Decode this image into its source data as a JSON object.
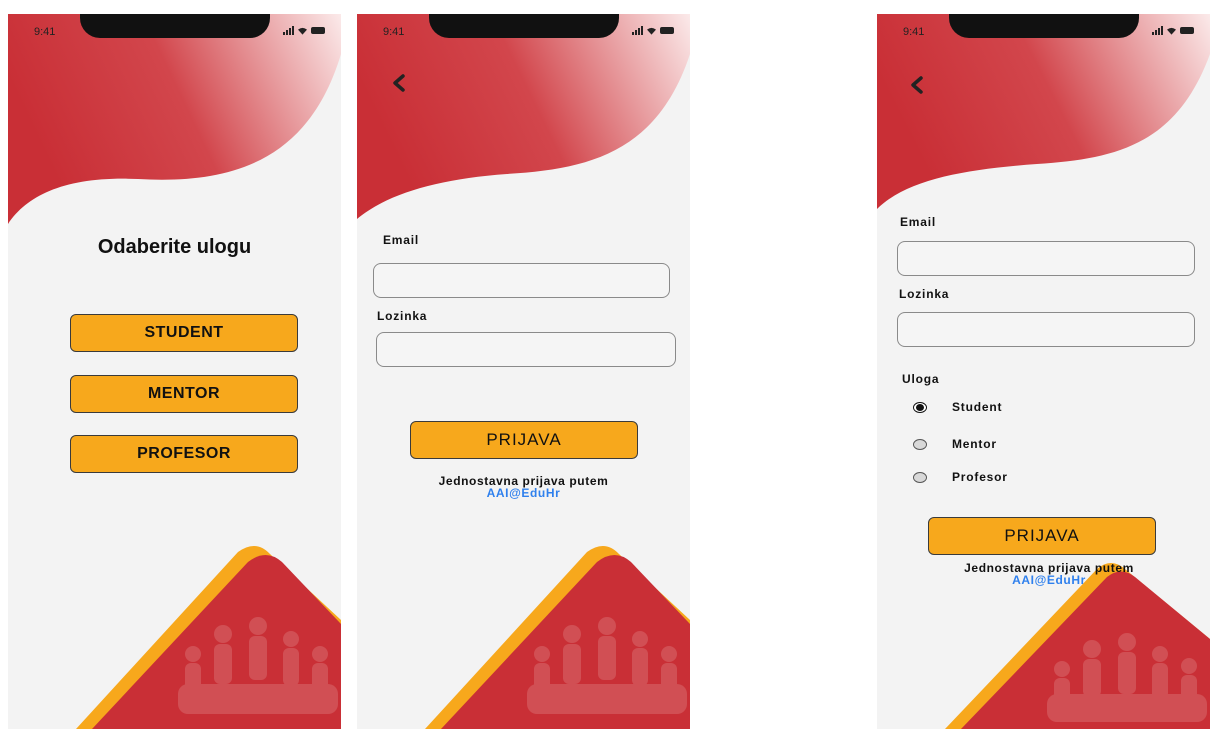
{
  "status_bar": {
    "time": "9:41"
  },
  "icons": {
    "back": "chevron-left-icon",
    "signal": "signal-icon",
    "wifi": "wifi-icon",
    "battery": "battery-icon"
  },
  "colors": {
    "red": "#c92f36",
    "yellow": "#f7a81c",
    "link": "#2f80ed",
    "background": "#f3f3f3"
  },
  "role_screen": {
    "title": "Odaberite ulogu",
    "buttons": [
      "STUDENT",
      "MENTOR",
      "PROFESOR"
    ]
  },
  "login_screen": {
    "email_label": "Email",
    "email_value": "",
    "password_label": "Lozinka",
    "password_value": "",
    "submit_label": "PRIJAVA",
    "alt_text": "Jednostavna prijava putem",
    "alt_link": "AAI@EduHr"
  },
  "login_role_screen": {
    "email_label": "Email",
    "email_value": "",
    "password_label": "Lozinka",
    "password_value": "",
    "role_label": "Uloga",
    "roles": [
      "Student",
      "Mentor",
      "Profesor"
    ],
    "selected_role": "Student",
    "submit_label": "PRIJAVA",
    "alt_text": "Jednostavna prijava putem",
    "alt_link": "AAI@EduHr"
  }
}
